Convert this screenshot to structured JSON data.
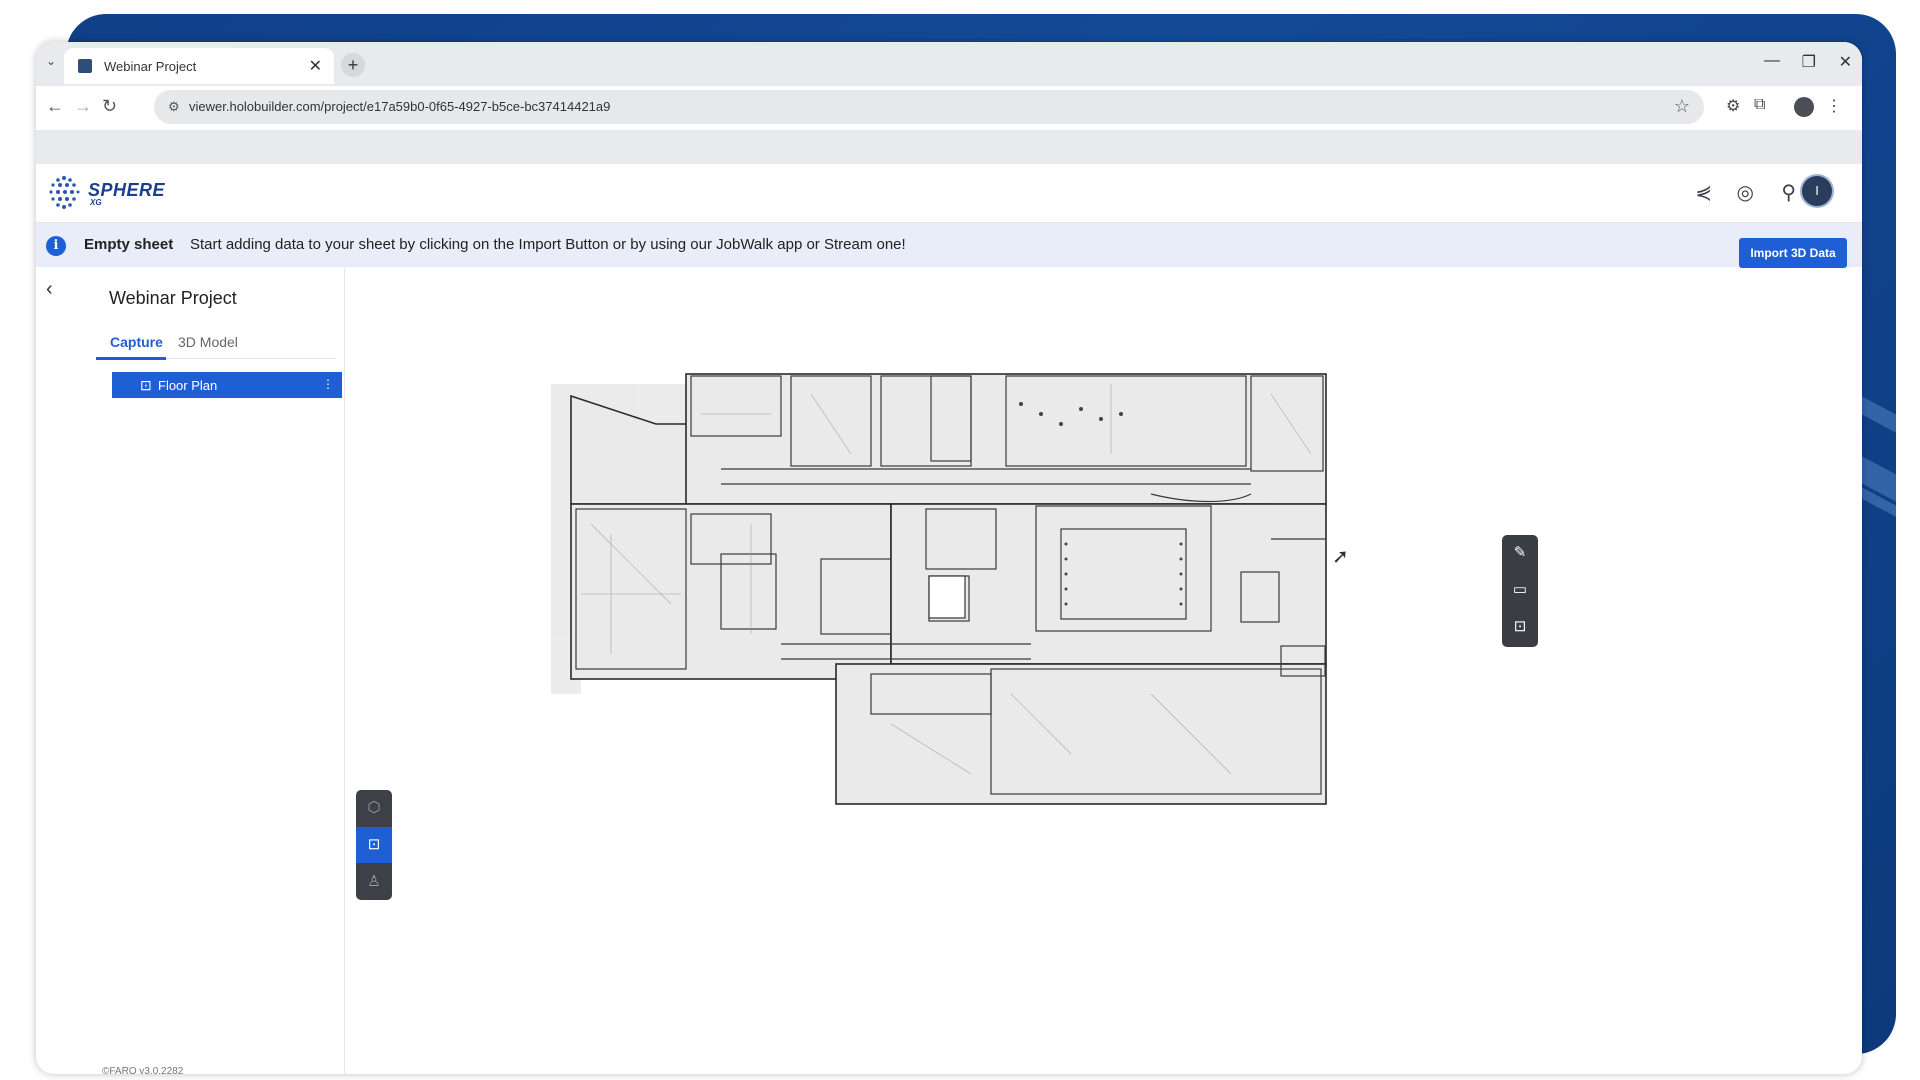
{
  "browser": {
    "tab_title": "Webinar Project",
    "url": "viewer.holobuilder.com/project/e17a59b0-0f65-4927-b5ce-bc37414421a9"
  },
  "app": {
    "logo_text": "SPHERE",
    "logo_sub": "XG",
    "avatar_initial": "I",
    "colors": {
      "accent": "#1f5fd6",
      "brand": "#1b3f8f",
      "banner_bg": "#e8edf9"
    }
  },
  "banner": {
    "title": "Empty sheet",
    "message": "Start adding data to your sheet by clicking on the Import Button or by using our JobWalk app or Stream one!"
  },
  "sidebar": {
    "project_title": "Webinar Project",
    "tabs": [
      {
        "label": "Capture",
        "active": true
      },
      {
        "label": "3D Model",
        "active": false
      }
    ],
    "items": [
      {
        "label": "Floor Plan",
        "selected": true
      }
    ],
    "version": "©FARO v3.0.2282"
  },
  "main": {
    "import_label": "Import 3D Data",
    "view_tools": [
      "3d-view-icon",
      "floor-plan-icon",
      "walk-icon"
    ],
    "side_tools": [
      "pencil-icon",
      "comment-icon",
      "floor-plan-info-icon"
    ]
  }
}
